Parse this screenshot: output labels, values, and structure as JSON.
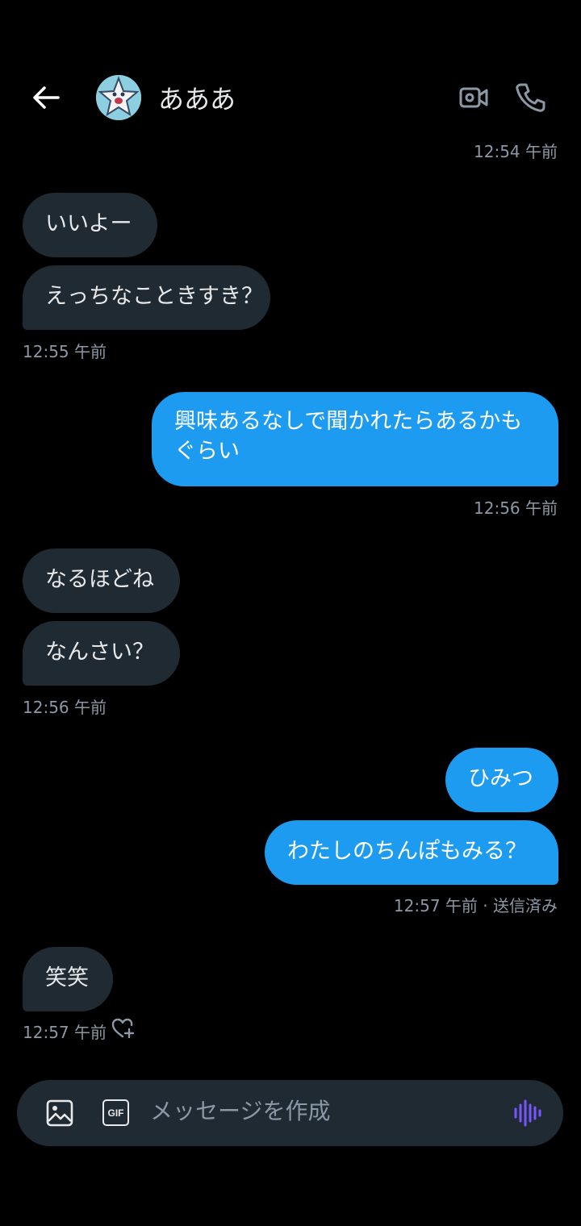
{
  "header": {
    "contact_name": "あああ",
    "back_icon": "arrow-left-icon",
    "video_icon": "video-camera-icon",
    "call_icon": "phone-icon"
  },
  "messages": [
    {
      "type": "timestamp",
      "text": "12:54 午前"
    },
    {
      "type": "in",
      "text": "いいよー"
    },
    {
      "type": "in",
      "text": "えっちなこときすき？"
    },
    {
      "type": "timestamp",
      "text": "12:55 午前"
    },
    {
      "type": "out",
      "lines": [
        "興味あるなしで聞かれたらあるかも",
        "ぐらい"
      ]
    },
    {
      "type": "timestamp",
      "text": "12:56 午前"
    },
    {
      "type": "in",
      "text": "なるほどね"
    },
    {
      "type": "in",
      "text": "なんさい？"
    },
    {
      "type": "timestamp",
      "text": "12:56 午前"
    },
    {
      "type": "out",
      "text": "ひみつ"
    },
    {
      "type": "out",
      "text": "わたしのちんぽもみる？"
    },
    {
      "type": "timestamp",
      "text": "12:57 午前 · 送信済み"
    },
    {
      "type": "in",
      "text": "笑笑"
    },
    {
      "type": "timestamp",
      "text": "12:57 午前"
    }
  ],
  "composer": {
    "placeholder": "メッセージを作成",
    "image_icon": "image-icon",
    "gif_label": "GIF",
    "voice_icon": "voice-waveform-icon"
  },
  "colors": {
    "background": "#000000",
    "incoming_bubble": "#202a33",
    "outgoing_bubble": "#1d9bf0",
    "timestamp": "#8b98a5",
    "voice_accent": "#7856ff"
  }
}
